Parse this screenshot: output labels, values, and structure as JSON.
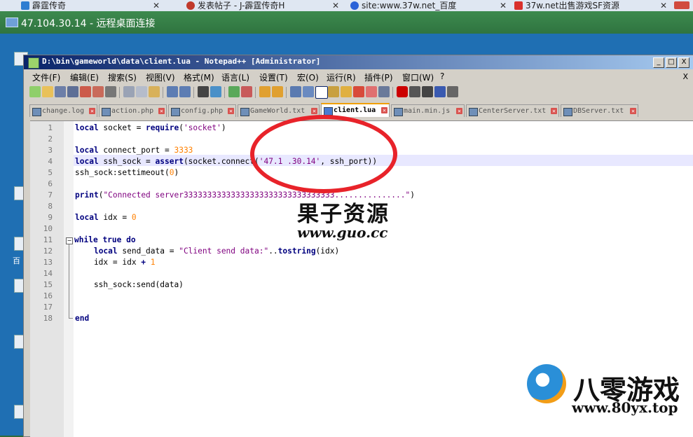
{
  "browser_tabs": [
    {
      "label": "霹霆传奇",
      "icon": "ie-icon"
    },
    {
      "label": "发表帖子 - J-霹霆传奇H",
      "icon": "forum-icon"
    },
    {
      "label": "site:www.37w.net_百度",
      "icon": "baidu-paw-icon"
    },
    {
      "label": "37w.net出售游戏SF资源",
      "icon": "site-icon"
    }
  ],
  "rdp": {
    "title": "47.104.30.14 - 远程桌面连接"
  },
  "desktop": {
    "icon_label": "百"
  },
  "npp": {
    "title": "D:\\bin\\gameworld\\data\\client.lua - Notepad++ [Administrator]",
    "window_buttons": [
      "_",
      "□",
      "X"
    ],
    "menu": [
      "文件(F)",
      "编辑(E)",
      "搜索(S)",
      "视图(V)",
      "格式(M)",
      "语言(L)",
      "设置(T)",
      "宏(O)",
      "运行(R)",
      "插件(P)",
      "窗口(W)",
      "?"
    ],
    "menu_close": "X",
    "file_tabs": [
      "change.log",
      "action.php",
      "config.php",
      "GameWorld.txt",
      "client.lua",
      "main.min.js",
      "CenterServer.txt",
      "DBServer.txt"
    ],
    "active_tab": "client.lua",
    "line_numbers": [
      "1",
      "2",
      "3",
      "4",
      "5",
      "6",
      "7",
      "8",
      "9",
      "10",
      "11",
      "12",
      "13",
      "14",
      "15",
      "16",
      "17",
      "18"
    ]
  },
  "code_lines": [
    "local socket = require('socket')",
    "",
    "local connect_port = 3333",
    "local ssh_sock = assert(socket.connect('47.1 .30.14', ssh_port))",
    "ssh_sock:settimeout(0)",
    "",
    "print(\"Connected server33333333333333333333333333333333...............\")",
    "",
    "local idx = 0",
    "",
    "while true do",
    "    local send_data = \"Client send data:\"..tostring(idx)",
    "    idx = idx + 1",
    "",
    "    ssh_sock:send(data)",
    "",
    "",
    "end"
  ],
  "watermark": {
    "cn": "果子资源",
    "url": "www.guo.cc"
  },
  "brand": {
    "cn": "八零游戏",
    "url": "www.80yx.top"
  },
  "colors": {
    "keyword": "#00007f",
    "string": "#7f007f",
    "number": "#ff8000",
    "annotation_ring": "#e8232a",
    "rdp_bar": "#2f7440"
  }
}
